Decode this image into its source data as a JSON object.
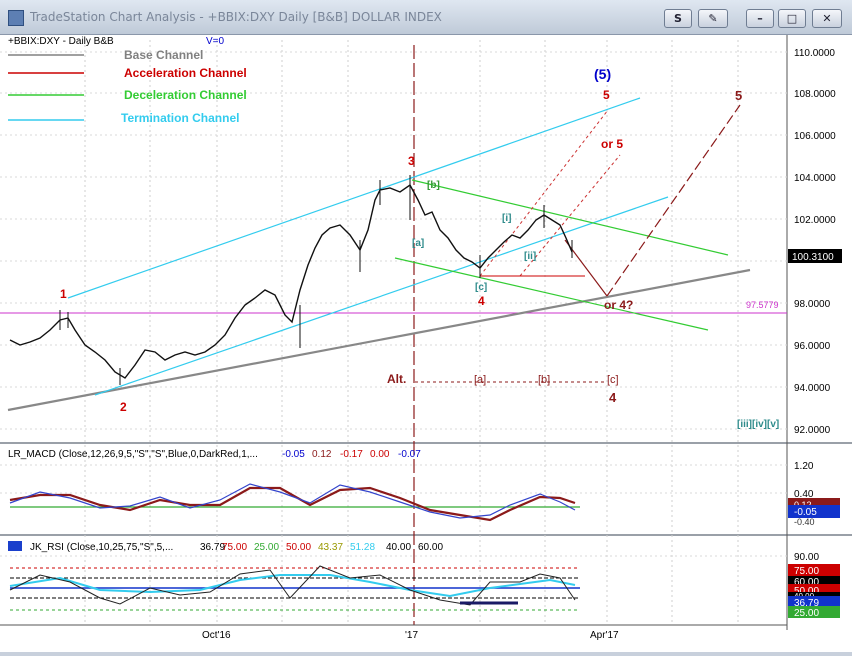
{
  "window": {
    "title": "TradeStation Chart Analysis - +BBIX:DXY Daily [B&B] DOLLAR INDEX",
    "btn_s": "S",
    "btn_pin": "✎",
    "btn_min": "–",
    "btn_max": "□",
    "btn_close": "✕"
  },
  "price_panel": {
    "symbol_label": "+BBIX:DXY - Daily  B&B",
    "volume_label": "V=0",
    "legend": [
      {
        "label": "Base Channel",
        "color": "#808080"
      },
      {
        "label": "Acceleration Channel",
        "color": "#cc0000"
      },
      {
        "label": "Deceleration Channel",
        "color": "#33cc33"
      },
      {
        "label": "Termination Channel",
        "color": "#33ccee"
      }
    ],
    "axis_ticks": [
      "110.0000",
      "108.0000",
      "106.0000",
      "104.0000",
      "102.0000",
      "98.0000",
      "96.0000",
      "94.0000",
      "92.0000"
    ],
    "last_price": "100.3100",
    "hline_value": "97.5779",
    "annotations": {
      "wave_1": "1",
      "wave_2": "2",
      "wave_3": "3",
      "wave_4": "4",
      "wave_5_top": "(5)",
      "wave_5_red": "5",
      "or5": "or 5",
      "far_5": "5",
      "or4": "or 4?",
      "b_bracket": "[b]",
      "a_bracket": "[a]",
      "c_bracket": "[c]",
      "i_bracket": "[i]",
      "ii_bracket": "[ii]",
      "alt_label": "Alt.",
      "alt_a": "[a]",
      "alt_b": "[b]",
      "alt_c": "[c]",
      "alt_4": "4",
      "iii_iv_v": "[iii][iv][v]"
    }
  },
  "macd_panel": {
    "label": "LR_MACD (Close,12,26,9,5,\"S\",\"S\",Blue,0,DarkRed,1,...",
    "values": [
      "-0.05",
      "0.12",
      "-0.17",
      "0.00",
      "-0.07"
    ],
    "axis_ticks": [
      "1.20",
      "0.40"
    ],
    "badges": [
      "0.12",
      "-0.05",
      "-0.40"
    ]
  },
  "rsi_panel": {
    "label": "JK_RSI (Close,10,25,75,\"S\",5,...",
    "values": [
      "36.79",
      "75.00",
      "25.00",
      "50.00",
      "43.37",
      "51.28",
      "40.00",
      "60.00"
    ],
    "axis_ticks": [
      "90.00"
    ],
    "badges": [
      "75.00",
      "60.00",
      "50.00",
      "40.00",
      "36.79",
      "25.00"
    ]
  },
  "time_axis": [
    "Oct'16",
    "'17",
    "Apr'17"
  ]
}
